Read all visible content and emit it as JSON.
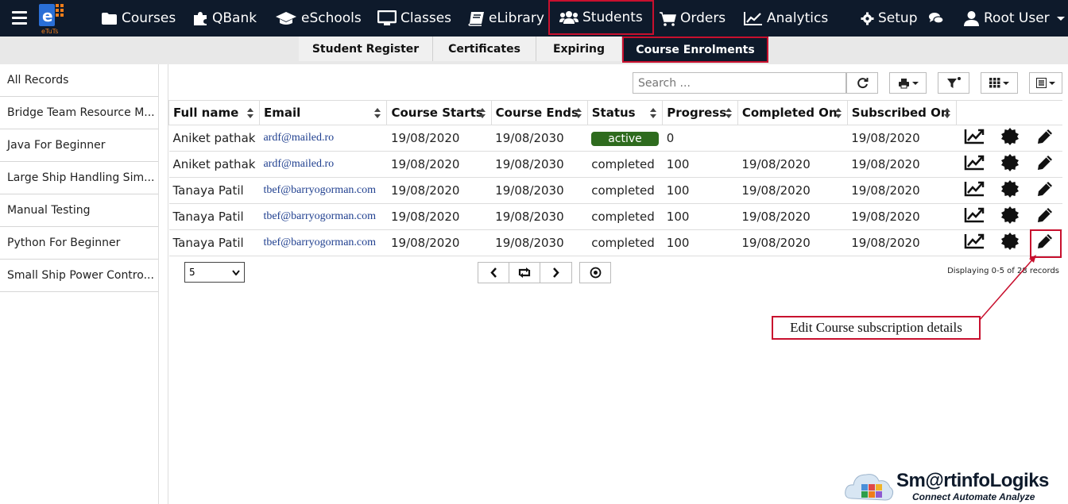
{
  "nav": {
    "logo_text": "eTuTs",
    "items": [
      {
        "label": "Courses"
      },
      {
        "label": "QBank"
      },
      {
        "label": "eSchools"
      },
      {
        "label": "Classes"
      },
      {
        "label": "eLibrary"
      },
      {
        "label": "Students"
      },
      {
        "label": "Orders"
      },
      {
        "label": "Analytics"
      }
    ],
    "setup_label": "Setup",
    "user_label": "Root User"
  },
  "subtabs": [
    {
      "label": "Student Register"
    },
    {
      "label": "Certificates"
    },
    {
      "label": "Expiring"
    },
    {
      "label": "Course Enrolments"
    }
  ],
  "sidebar": {
    "items": [
      {
        "label": "All Records"
      },
      {
        "label": "Bridge Team Resource M..."
      },
      {
        "label": "Java For Beginner"
      },
      {
        "label": "Large Ship Handling Sim..."
      },
      {
        "label": "Manual Testing"
      },
      {
        "label": "Python For Beginner"
      },
      {
        "label": "Small Ship Power Contro..."
      }
    ]
  },
  "toolbar": {
    "search_placeholder": "Search ..."
  },
  "table": {
    "headers": [
      "Full name",
      "Email",
      "Course Starts",
      "Course Ends",
      "Status",
      "Progress",
      "Completed On",
      "Subscribed On"
    ],
    "rows": [
      {
        "name": "Aniket pathak",
        "email": "ardf@mailed.ro",
        "starts": "19/08/2020",
        "ends": "19/08/2030",
        "status": "active",
        "progress": "0",
        "completed": "",
        "subscribed": "19/08/2020"
      },
      {
        "name": "Aniket pathak",
        "email": "ardf@mailed.ro",
        "starts": "19/08/2020",
        "ends": "19/08/2030",
        "status": "completed",
        "progress": "100",
        "completed": "19/08/2020",
        "subscribed": "19/08/2020"
      },
      {
        "name": "Tanaya Patil",
        "email": "tbef@barryogorman.com",
        "starts": "19/08/2020",
        "ends": "19/08/2030",
        "status": "completed",
        "progress": "100",
        "completed": "19/08/2020",
        "subscribed": "19/08/2020"
      },
      {
        "name": "Tanaya Patil",
        "email": "tbef@barryogorman.com",
        "starts": "19/08/2020",
        "ends": "19/08/2030",
        "status": "completed",
        "progress": "100",
        "completed": "19/08/2020",
        "subscribed": "19/08/2020"
      },
      {
        "name": "Tanaya Patil",
        "email": "tbef@barryogorman.com",
        "starts": "19/08/2020",
        "ends": "19/08/2030",
        "status": "completed",
        "progress": "100",
        "completed": "19/08/2020",
        "subscribed": "19/08/2020"
      }
    ]
  },
  "pager": {
    "page_size": "5",
    "displaying": "Displaying 0-5 of 28 records"
  },
  "annotation": {
    "text": "Edit Course subscription details"
  },
  "brand": {
    "name": "Sm@rtinfoLogiks",
    "tagline": "Connect Automate Analyze"
  },
  "colors": {
    "topbar": "#0e1a2b",
    "highlight": "#c8102e",
    "active_badge": "#2e6b1e"
  }
}
